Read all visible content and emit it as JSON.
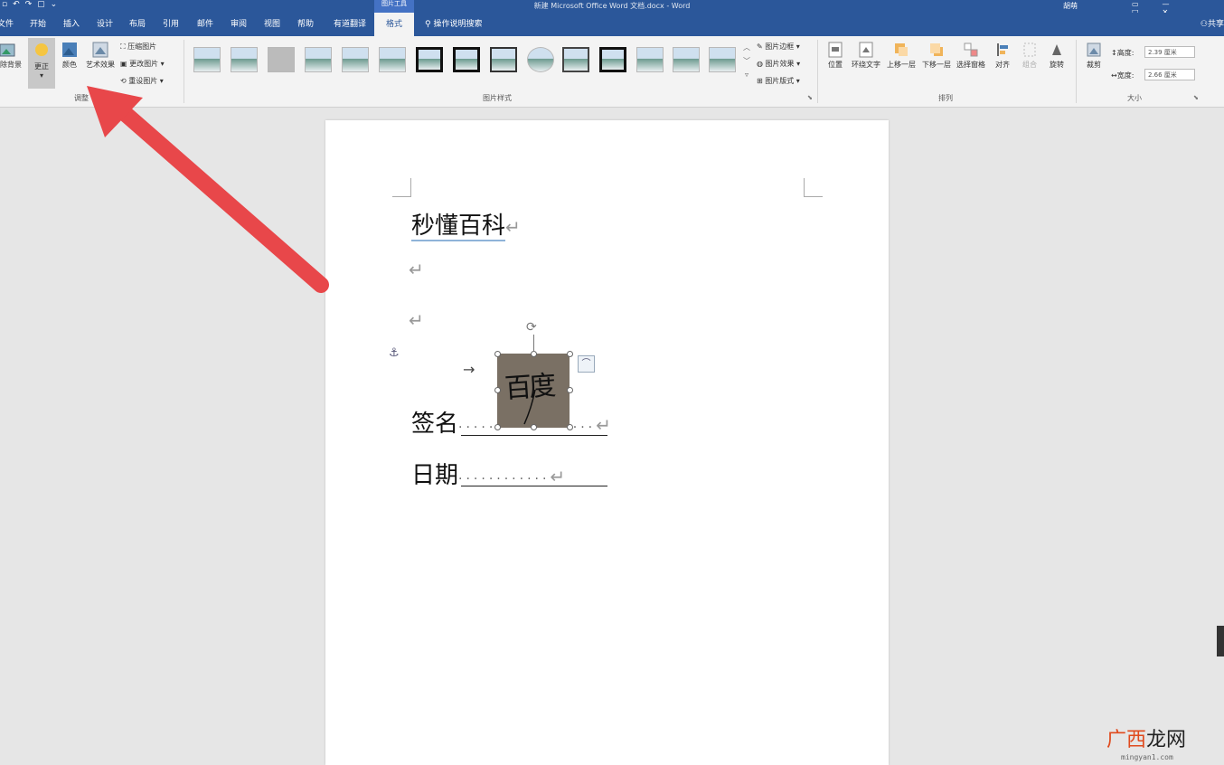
{
  "titlebar": {
    "title": "新建 Microsoft Office Word 文档.docx - Word",
    "context_tab": "图片工具",
    "user": "胡萌",
    "qat_icons": [
      "save-icon",
      "undo-icon",
      "redo-icon",
      "print-preview-icon",
      "customize-icon"
    ]
  },
  "tabs": [
    "文件",
    "开始",
    "插入",
    "设计",
    "布局",
    "引用",
    "邮件",
    "审阅",
    "视图",
    "帮助",
    "有道翻译",
    "格式"
  ],
  "tell_me": "操作说明搜索",
  "share": "共享",
  "ribbon": {
    "adjust": {
      "remove_bg": "删除背景",
      "corrections": "更正",
      "color": "颜色",
      "art_effects": "艺术效果",
      "compress": "压缩图片",
      "change": "更改图片",
      "reset": "重设图片",
      "label": "调整"
    },
    "styles": {
      "label": "图片样式",
      "border": "图片边框",
      "effects": "图片效果",
      "layout": "图片版式"
    },
    "arrange": {
      "label": "排列",
      "position": "位置",
      "wrap": "环绕文字",
      "forward": "上移一层",
      "backward": "下移一层",
      "selection": "选择窗格",
      "align": "对齐",
      "group": "组合",
      "rotate": "旋转"
    },
    "size": {
      "label": "大小",
      "crop": "裁剪",
      "height_label": "高度:",
      "height_value": "2.39 厘米",
      "width_label": "宽度:",
      "width_value": "2.66 厘米"
    }
  },
  "document": {
    "title": "秒懂百科",
    "sign_label": "签名",
    "date_label": "日期",
    "tab_arrow": "→",
    "para_mark": "↵",
    "signature_image_text": "百度"
  },
  "watermark": {
    "brand_red": "广西",
    "brand_dark": "龙网",
    "url": "mingyan1.com"
  },
  "colors": {
    "titlebar": "#2b579a",
    "arrow": "#e8474a",
    "image_bg": "#7a7064"
  }
}
